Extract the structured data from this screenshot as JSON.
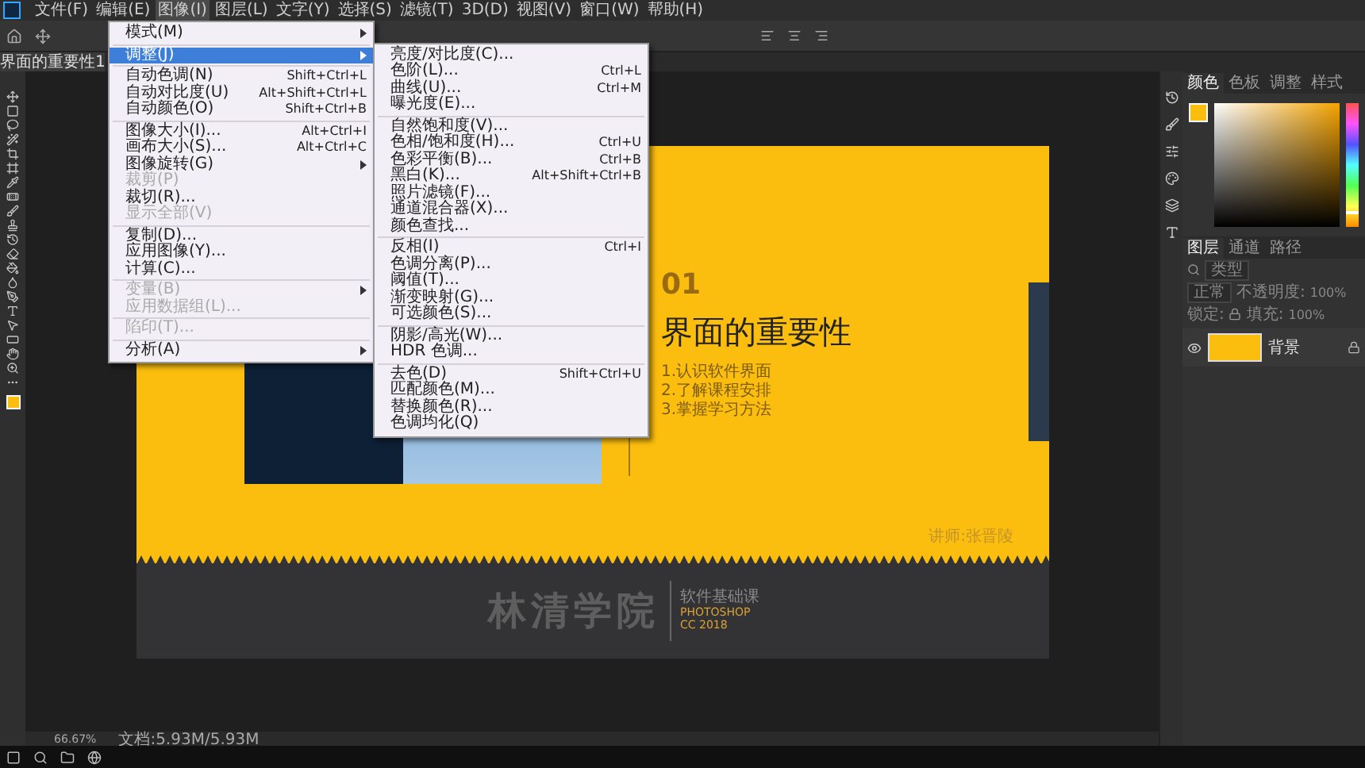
{
  "menubar": [
    {
      "label": "文件(F)",
      "selected": false
    },
    {
      "label": "编辑(E)",
      "selected": false
    },
    {
      "label": "图像(I)",
      "selected": true
    },
    {
      "label": "图层(L)",
      "selected": false
    },
    {
      "label": "文字(Y)",
      "selected": false
    },
    {
      "label": "选择(S)",
      "selected": false
    },
    {
      "label": "滤镜(T)",
      "selected": false
    },
    {
      "label": "3D(D)",
      "selected": false
    },
    {
      "label": "视图(V)",
      "selected": false
    },
    {
      "label": "窗口(W)",
      "selected": false
    },
    {
      "label": "帮助(H)",
      "selected": false
    }
  ],
  "image_menu": [
    {
      "kind": "item",
      "label": "模式(M)",
      "submenu": true,
      "selected": false,
      "disabled": false
    },
    {
      "kind": "separator"
    },
    {
      "kind": "item",
      "label": "调整(J)",
      "submenu": true,
      "selected": true,
      "disabled": false
    },
    {
      "kind": "separator"
    },
    {
      "kind": "item",
      "label": "自动色调(N)",
      "shortcut": "Shift+Ctrl+L",
      "selected": false,
      "disabled": false
    },
    {
      "kind": "item",
      "label": "自动对比度(U)",
      "shortcut": "Alt+Shift+Ctrl+L",
      "selected": false,
      "disabled": false
    },
    {
      "kind": "item",
      "label": "自动颜色(O)",
      "shortcut": "Shift+Ctrl+B",
      "selected": false,
      "disabled": false
    },
    {
      "kind": "separator"
    },
    {
      "kind": "item",
      "label": "图像大小(I)...",
      "shortcut": "Alt+Ctrl+I",
      "selected": false,
      "disabled": false
    },
    {
      "kind": "item",
      "label": "画布大小(S)...",
      "shortcut": "Alt+Ctrl+C",
      "selected": false,
      "disabled": false
    },
    {
      "kind": "item",
      "label": "图像旋转(G)",
      "submenu": true,
      "selected": false,
      "disabled": false
    },
    {
      "kind": "item",
      "label": "裁剪(P)",
      "selected": false,
      "disabled": true
    },
    {
      "kind": "item",
      "label": "裁切(R)...",
      "selected": false,
      "disabled": false
    },
    {
      "kind": "item",
      "label": "显示全部(V)",
      "selected": false,
      "disabled": true
    },
    {
      "kind": "separator"
    },
    {
      "kind": "item",
      "label": "复制(D)...",
      "selected": false,
      "disabled": false
    },
    {
      "kind": "item",
      "label": "应用图像(Y)...",
      "selected": false,
      "disabled": false
    },
    {
      "kind": "item",
      "label": "计算(C)...",
      "selected": false,
      "disabled": false
    },
    {
      "kind": "separator"
    },
    {
      "kind": "item",
      "label": "变量(B)",
      "submenu": true,
      "selected": false,
      "disabled": true
    },
    {
      "kind": "item",
      "label": "应用数据组(L)...",
      "selected": false,
      "disabled": true
    },
    {
      "kind": "separator"
    },
    {
      "kind": "item",
      "label": "陷印(T)...",
      "selected": false,
      "disabled": true
    },
    {
      "kind": "separator"
    },
    {
      "kind": "item",
      "label": "分析(A)",
      "submenu": true,
      "selected": false,
      "disabled": false
    }
  ],
  "adjust_submenu": [
    {
      "kind": "item",
      "label": "亮度/对比度(C)..."
    },
    {
      "kind": "item",
      "label": "色阶(L)...",
      "shortcut": "Ctrl+L"
    },
    {
      "kind": "item",
      "label": "曲线(U)...",
      "shortcut": "Ctrl+M"
    },
    {
      "kind": "item",
      "label": "曝光度(E)..."
    },
    {
      "kind": "separator"
    },
    {
      "kind": "item",
      "label": "自然饱和度(V)..."
    },
    {
      "kind": "item",
      "label": "色相/饱和度(H)...",
      "shortcut": "Ctrl+U"
    },
    {
      "kind": "item",
      "label": "色彩平衡(B)...",
      "shortcut": "Ctrl+B"
    },
    {
      "kind": "item",
      "label": "黑白(K)...",
      "shortcut": "Alt+Shift+Ctrl+B"
    },
    {
      "kind": "item",
      "label": "照片滤镜(F)..."
    },
    {
      "kind": "item",
      "label": "通道混合器(X)..."
    },
    {
      "kind": "item",
      "label": "颜色查找..."
    },
    {
      "kind": "separator"
    },
    {
      "kind": "item",
      "label": "反相(I)",
      "shortcut": "Ctrl+I"
    },
    {
      "kind": "item",
      "label": "色调分离(P)..."
    },
    {
      "kind": "item",
      "label": "阈值(T)..."
    },
    {
      "kind": "item",
      "label": "渐变映射(G)..."
    },
    {
      "kind": "item",
      "label": "可选颜色(S)..."
    },
    {
      "kind": "separator"
    },
    {
      "kind": "item",
      "label": "阴影/高光(W)..."
    },
    {
      "kind": "item",
      "label": "HDR 色调..."
    },
    {
      "kind": "separator"
    },
    {
      "kind": "item",
      "label": "去色(D)",
      "shortcut": "Shift+Ctrl+U"
    },
    {
      "kind": "item",
      "label": "匹配颜色(M)..."
    },
    {
      "kind": "item",
      "label": "替换颜色(R)..."
    },
    {
      "kind": "item",
      "label": "色调均化(Q)"
    }
  ],
  "document_tab": {
    "title": "界面的重要性1"
  },
  "slide": {
    "number": "01",
    "title": "界面的重要性",
    "points": [
      "1.认识软件界面",
      "2.了解课程安排",
      "3.掌握学习方法"
    ],
    "lecturer": "讲师:张晋陵",
    "brand": {
      "name": "林清学院",
      "course": "软件基础课",
      "product": "PHOTOSHOP",
      "version": "CC 2018"
    }
  },
  "color_panel": {
    "hue": {
      "level": 0.9
    },
    "tabs": [
      {
        "label": "颜色",
        "selected": true
      },
      {
        "label": "色板",
        "selected": false
      },
      {
        "label": "调整",
        "selected": false
      },
      {
        "label": "样式",
        "selected": false
      }
    ]
  },
  "layers_panel": {
    "tabs": [
      {
        "label": "图层",
        "selected": true
      },
      {
        "label": "通道",
        "selected": false
      },
      {
        "label": "路径",
        "selected": false
      }
    ],
    "filter_placeholder": "类型",
    "blend_mode": "正常",
    "opacity_label": "不透明度:",
    "opacity": "100%",
    "lock_label": "锁定:",
    "fill_label": "填充:",
    "fill": "100%",
    "layers": [
      {
        "name": "背景",
        "visible": true,
        "locked": true,
        "selected": false
      }
    ]
  },
  "status_bar": {
    "zoom": "66.67%",
    "document": "文档:5.93M/5.93M"
  }
}
